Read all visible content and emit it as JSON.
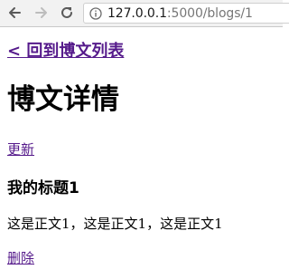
{
  "browser": {
    "url_host": "127.0.0.1",
    "url_path": ":5000/blogs/1"
  },
  "page": {
    "back_link": "< 回到博文列表",
    "title": "博文详情",
    "update_link": "更新",
    "blog_title": "我的标题1",
    "blog_body": "这是正文1，这是正文1，这是正文1",
    "delete_link": "删除"
  },
  "icons": {
    "back": "arrow-left-icon",
    "forward": "arrow-right-icon",
    "reload": "reload-icon",
    "info": "info-icon"
  },
  "colors": {
    "visited_link": "#551a8b",
    "toolbar_bg": "#f2f2f2"
  }
}
